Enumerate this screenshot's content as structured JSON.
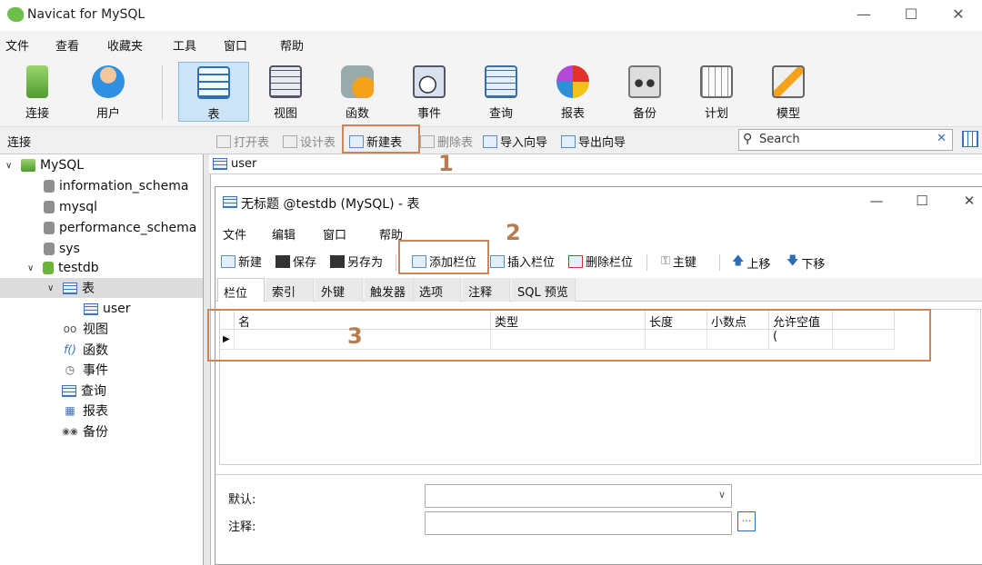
{
  "app": {
    "title": "Navicat for MySQL"
  },
  "menubar": [
    "文件",
    "查看",
    "收藏夹",
    "工具",
    "窗口",
    "帮助"
  ],
  "toolbar": {
    "items": [
      "连接",
      "用户",
      "表",
      "视图",
      "函数",
      "事件",
      "查询",
      "报表",
      "备份",
      "计划",
      "模型"
    ],
    "active": "表"
  },
  "subbar": {
    "section_label": "连接",
    "items": [
      "打开表",
      "设计表",
      "新建表",
      "删除表",
      "导入向导",
      "导出向导"
    ]
  },
  "search": {
    "placeholder": "Search"
  },
  "sidebar": {
    "connection": "MySQL",
    "databases": [
      "information_schema",
      "mysql",
      "performance_schema",
      "sys",
      "testdb"
    ],
    "table_group": "表",
    "tables": [
      "user"
    ],
    "groups": [
      "视图",
      "函数",
      "事件",
      "查询",
      "报表",
      "备份"
    ]
  },
  "tabstrip": {
    "tab": "user"
  },
  "inner_window": {
    "title": "无标题 @testdb (MySQL) - 表",
    "menu": [
      "文件",
      "编辑",
      "窗口",
      "帮助"
    ],
    "tools": [
      "新建",
      "保存",
      "另存为",
      "添加栏位",
      "插入栏位",
      "删除栏位",
      "主键",
      "上移",
      "下移"
    ],
    "tabs": [
      "栏位",
      "索引",
      "外键",
      "触发器",
      "选项",
      "注释",
      "SQL 预览"
    ],
    "columns": [
      "名",
      "类型",
      "长度",
      "小数点",
      "允许空值 ("
    ],
    "form": {
      "default_label": "默认:",
      "comment_label": "注释:"
    }
  },
  "annotations": [
    "1",
    "2",
    "3"
  ]
}
